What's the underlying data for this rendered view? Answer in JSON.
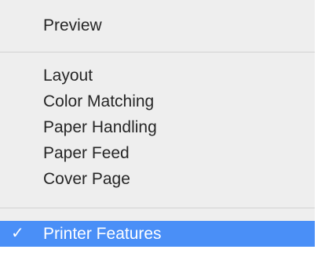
{
  "menu": {
    "items": [
      {
        "label": "Preview"
      },
      {
        "label": "Layout"
      },
      {
        "label": "Color Matching"
      },
      {
        "label": "Paper Handling"
      },
      {
        "label": "Paper Feed"
      },
      {
        "label": "Cover Page"
      }
    ],
    "selected": {
      "label": "Printer Features",
      "check": "✓",
      "check_icon": "checkmark-icon",
      "highlight_color": "#4a8ff7"
    }
  }
}
